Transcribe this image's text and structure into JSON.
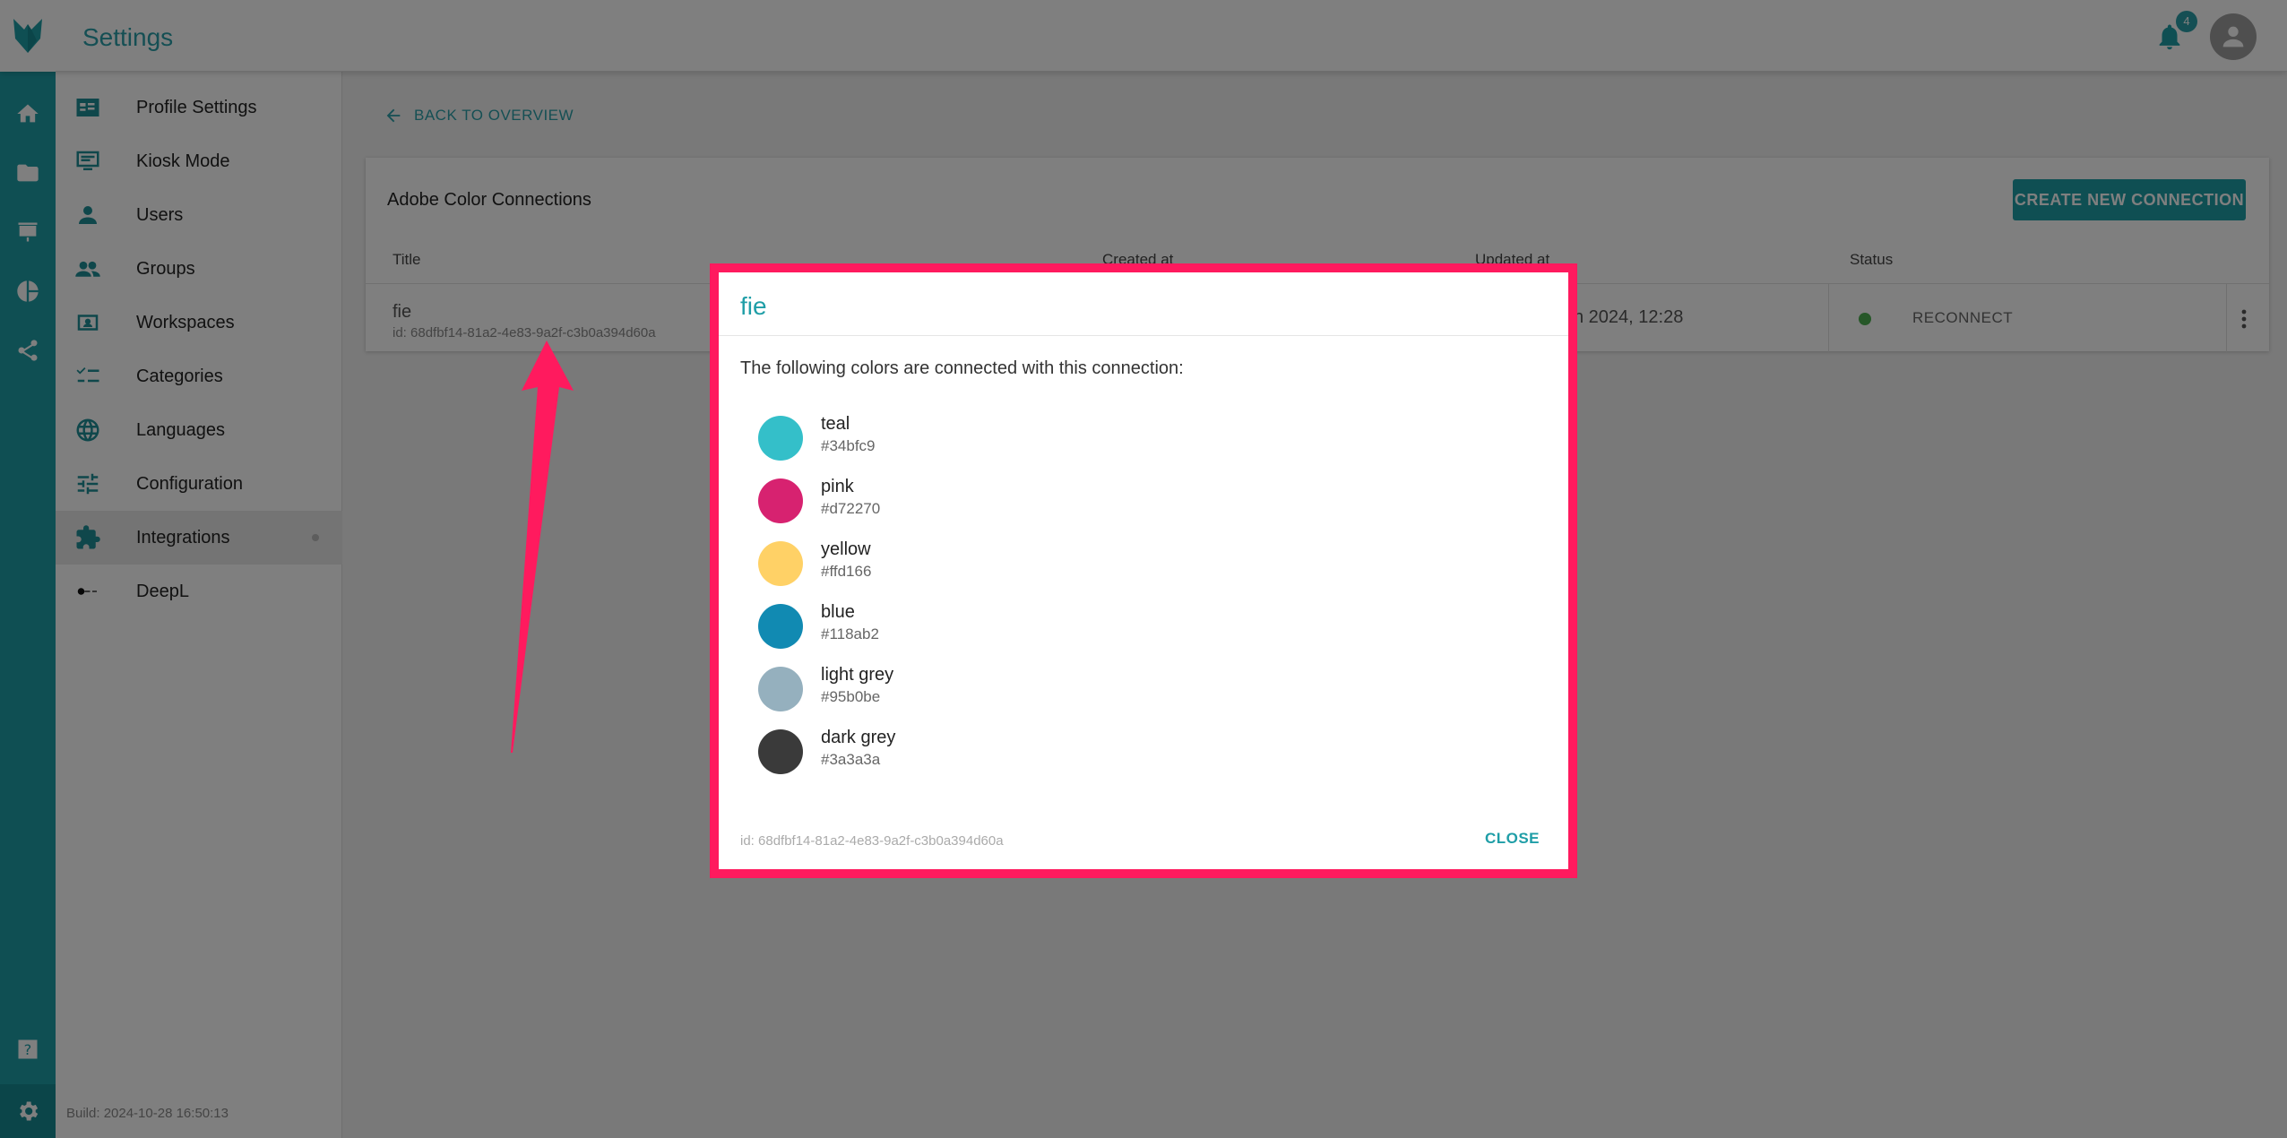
{
  "app": {
    "title": "Settings",
    "notification_count": "4"
  },
  "sidebar": {
    "items": [
      {
        "label": "Profile Settings",
        "icon": "profile-card-icon"
      },
      {
        "label": "Kiosk Mode",
        "icon": "monitor-icon"
      },
      {
        "label": "Users",
        "icon": "person-icon"
      },
      {
        "label": "Groups",
        "icon": "group-icon"
      },
      {
        "label": "Workspaces",
        "icon": "workspace-icon"
      },
      {
        "label": "Categories",
        "icon": "checklist-icon"
      },
      {
        "label": "Languages",
        "icon": "globe-icon"
      },
      {
        "label": "Configuration",
        "icon": "sliders-icon"
      },
      {
        "label": "Integrations",
        "icon": "puzzle-icon",
        "active": true
      },
      {
        "label": "DeepL",
        "icon": "deepl-icon"
      }
    ],
    "build": "Build: 2024-10-28 16:50:13"
  },
  "main": {
    "back_label": "BACK TO OVERVIEW",
    "card_title": "Adobe Color Connections",
    "create_label": "CREATE NEW CONNECTION",
    "columns": [
      "Title",
      "Created at",
      "Updated at",
      "Status"
    ],
    "row": {
      "title": "fie",
      "id": "id: 68dfbf14-81a2-4e83-9a2f-c3b0a394d60a",
      "updated_partial": "h 2024, 12:28",
      "status_label": "RECONNECT"
    }
  },
  "dialog": {
    "title": "fie",
    "text": "The following colors are connected with this connection:",
    "colors": [
      {
        "name": "teal",
        "hex": "#34bfc9"
      },
      {
        "name": "pink",
        "hex": "#d72270"
      },
      {
        "name": "yellow",
        "hex": "#ffd166"
      },
      {
        "name": "blue",
        "hex": "#118ab2"
      },
      {
        "name": "light grey",
        "hex": "#95b0be"
      },
      {
        "name": "dark grey",
        "hex": "#3a3a3a"
      }
    ],
    "id": "id: 68dfbf14-81a2-4e83-9a2f-c3b0a394d60a",
    "close_label": "CLOSE"
  },
  "theme": {
    "accent": "#1f9ea7",
    "highlight": "#ff1a5e",
    "status_ok": "#4caf50"
  }
}
